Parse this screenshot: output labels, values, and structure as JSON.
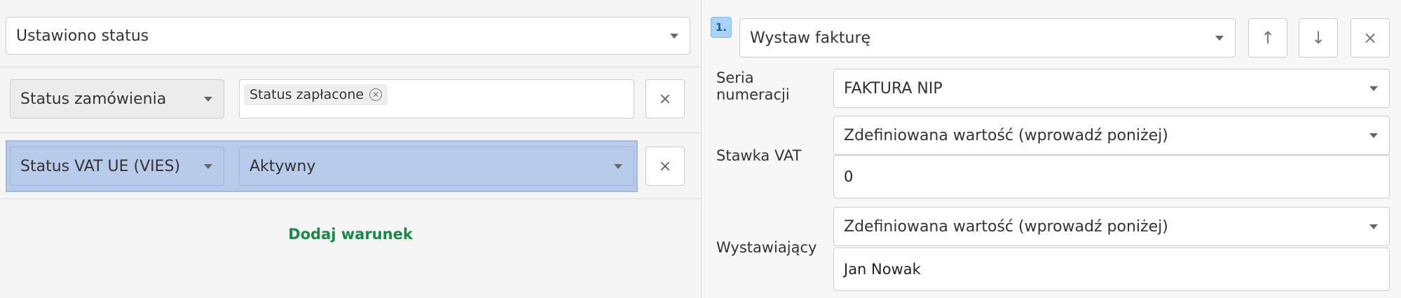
{
  "conditions": {
    "trigger_select": "Ustawiono status",
    "rows": [
      {
        "field": "Status zamówienia",
        "tag": "Status zapłacone",
        "remove_label": "×"
      },
      {
        "field": "Status VAT UE (VIES)",
        "value": "Aktywny",
        "remove_label": "×"
      }
    ],
    "add_condition_label": "Dodaj warunek"
  },
  "action": {
    "index": "1.",
    "type_select": "Wystaw fakturę",
    "up_label": "↑",
    "down_label": "↓",
    "close_label": "×",
    "numbering_label_line1": "Seria",
    "numbering_label_line2": "numeracji",
    "numbering_value": "FAKTURA NIP",
    "vat_label": "Stawka VAT",
    "vat_mode": "Zdefiniowana wartość (wprowadź poniżej)",
    "vat_value": "0",
    "issuer_label": "Wystawiający",
    "issuer_mode": "Zdefiniowana wartość (wprowadź poniżej)",
    "issuer_value": "Jan Nowak"
  },
  "colors": {
    "highlight": "#b9cbeb",
    "link_green": "#178a45",
    "badge_blue": "#a9d3f6"
  }
}
